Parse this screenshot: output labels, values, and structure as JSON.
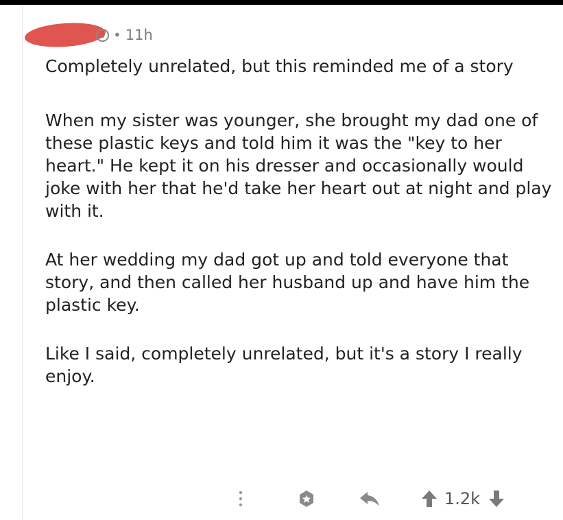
{
  "comment": {
    "username": "",
    "age": "11h",
    "flair_icon": "5",
    "paragraphs": [
      "Completely unrelated, but this reminded me of a story",
      "When my sister was younger, she brought my dad one of these plastic keys and told him it was the \"key to her heart.\" He kept it on his dresser and occasionally would joke with her that he'd take her heart out at night and play with it.",
      "At her wedding my dad got up and told everyone that story, and then called her husband up and have him the plastic key.",
      "Like I said, completely unrelated, but it's a story I really enjoy."
    ],
    "score": "1.2k"
  },
  "icons": {
    "more": "more-vertical-icon",
    "save": "save-icon",
    "reply": "reply-icon",
    "upvote": "upvote-arrow-icon",
    "downvote": "downvote-arrow-icon"
  },
  "colors": {
    "redaction": "#e0554f",
    "text": "#222222",
    "meta": "#7c7c7c"
  }
}
